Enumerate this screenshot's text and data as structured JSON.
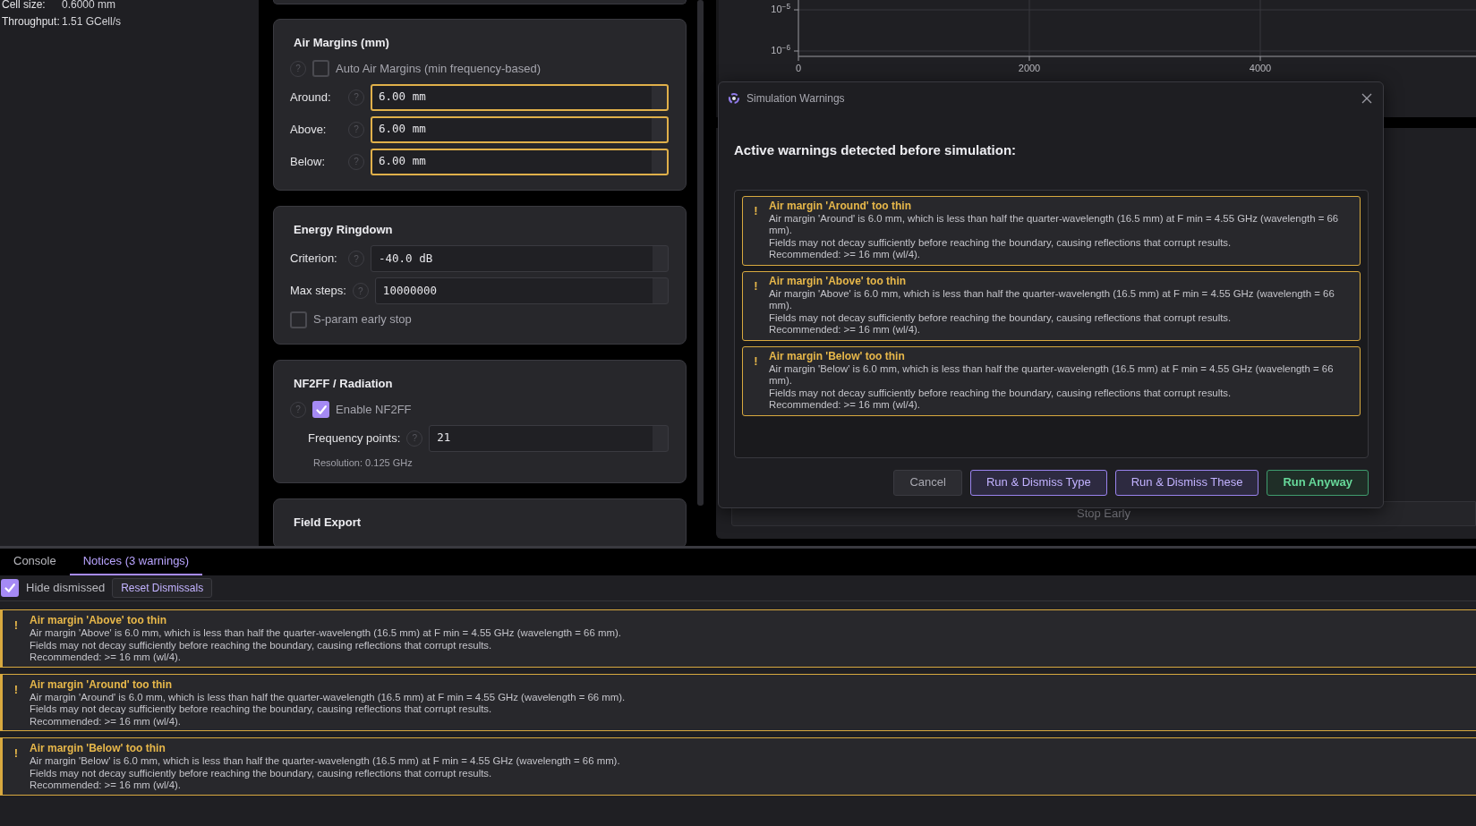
{
  "info_panel": {
    "rows": [
      {
        "label": "Cell size:",
        "value": "0.6000 mm"
      },
      {
        "label": "Throughput:",
        "value": "1.51 GCell/s"
      }
    ]
  },
  "settings_sections": [
    {
      "title": "Air Margins (mm)",
      "items": [
        {
          "kind": "checkbox",
          "help": "?",
          "label": "Auto Air Margins (min frequency-based)",
          "checked": false
        },
        {
          "kind": "field",
          "help": "?",
          "label": "Around:",
          "value": "6.00 mm",
          "warning": true
        },
        {
          "kind": "field",
          "help": "?",
          "label": "Above:",
          "value": "6.00 mm",
          "warning": true
        },
        {
          "kind": "field",
          "help": "?",
          "label": "Below:",
          "value": "6.00 mm",
          "warning": true
        }
      ]
    },
    {
      "title": "Energy Ringdown",
      "items": [
        {
          "kind": "field",
          "help": "?",
          "label": "Criterion:",
          "value": "-40.0 dB",
          "warning": false
        },
        {
          "kind": "field",
          "help": "?",
          "label": "Max steps:",
          "value": "10000000",
          "warning": false
        },
        {
          "kind": "checkbox",
          "label": "S-param early stop",
          "checked": false
        }
      ]
    },
    {
      "title": "NF2FF / Radiation",
      "items": [
        {
          "kind": "checkbox",
          "help": "?",
          "label": "Enable NF2FF",
          "checked": true
        },
        {
          "kind": "subfield",
          "help": "?",
          "label": "Frequency points:",
          "value": "21",
          "warning": false
        },
        {
          "kind": "note",
          "label": "Resolution: 0.125 GHz"
        }
      ]
    },
    {
      "title": "Field Export"
    }
  ],
  "plot": {
    "yticks": [
      "10$^{−5}$",
      "10$^{−6}$"
    ],
    "xticks": [
      "0",
      "2000",
      "4000"
    ]
  },
  "run_panel": {
    "button": "Stop Early"
  },
  "dialog": {
    "title": "Simulation Warnings",
    "heading": "Active warnings detected before simulation:",
    "warnings": [
      {
        "icon": "!",
        "title": "Air margin 'Around' too thin",
        "lines": [
          "Air margin 'Around' is 6.0 mm, which is less than half the quarter-wavelength (16.5 mm) at F min = 4.55 GHz (wavelength = 66 mm).",
          "Fields may not decay sufficiently before reaching the boundary, causing reflections that corrupt results.",
          "Recommended: >= 16 mm (wl/4)."
        ]
      },
      {
        "icon": "!",
        "title": "Air margin 'Above' too thin",
        "lines": [
          "Air margin 'Above' is 6.0 mm, which is less than half the quarter-wavelength (16.5 mm) at F min = 4.55 GHz (wavelength = 66 mm).",
          "Fields may not decay sufficiently before reaching the boundary, causing reflections that corrupt results.",
          "Recommended: >= 16 mm (wl/4)."
        ]
      },
      {
        "icon": "!",
        "title": "Air margin 'Below' too thin",
        "lines": [
          "Air margin 'Below' is 6.0 mm, which is less than half the quarter-wavelength (16.5 mm) at F min = 4.55 GHz (wavelength = 66 mm).",
          "Fields may not decay sufficiently before reaching the boundary, causing reflections that corrupt results.",
          "Recommended: >= 16 mm (wl/4)."
        ]
      }
    ],
    "buttons": [
      {
        "label": "Cancel",
        "kind": "neutral"
      },
      {
        "label": "Run & Dismiss Type",
        "kind": "accent"
      },
      {
        "label": "Run & Dismiss These",
        "kind": "accent"
      },
      {
        "label": "Run Anyway",
        "kind": "go"
      }
    ]
  },
  "bottom_tabs": [
    {
      "label": "Console",
      "selected": false
    },
    {
      "label": "Notices (3 warnings)",
      "selected": true
    }
  ],
  "notices_toolbar": {
    "hide_dismissed": {
      "label": "Hide dismissed",
      "checked": true
    },
    "reset_button": "Reset Dismissals"
  },
  "notices": [
    {
      "icon": "!",
      "title": "Air margin 'Above' too thin",
      "lines": [
        "Air margin 'Above' is 6.0 mm, which is less than half the quarter-wavelength (16.5 mm) at F min = 4.55 GHz (wavelength = 66 mm).",
        "Fields may not decay sufficiently before reaching the boundary, causing reflections that corrupt results.",
        "Recommended: >= 16 mm (wl/4)."
      ]
    },
    {
      "icon": "!",
      "title": "Air margin 'Around' too thin",
      "lines": [
        "Air margin 'Around' is 6.0 mm, which is less than half the quarter-wavelength (16.5 mm) at F min = 4.55 GHz (wavelength = 66 mm).",
        "Fields may not decay sufficiently before reaching the boundary, causing reflections that corrupt results.",
        "Recommended: >= 16 mm (wl/4)."
      ]
    },
    {
      "icon": "!",
      "title": "Air margin 'Below' too thin",
      "lines": [
        "Air margin 'Below' is 6.0 mm, which is less than half the quarter-wavelength (16.5 mm) at F min = 4.55 GHz (wavelength = 66 mm).",
        "Fields may not decay sufficiently before reaching the boundary, causing reflections that corrupt results.",
        "Recommended: >= 16 mm (wl/4)."
      ]
    }
  ]
}
